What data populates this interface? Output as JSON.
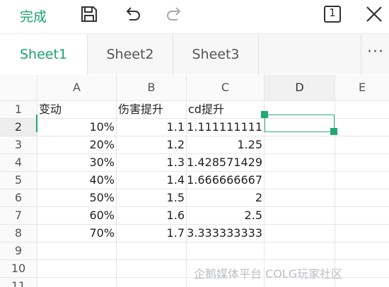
{
  "toolbar": {
    "done_label": "完成",
    "icons": [
      "save-icon",
      "undo-icon",
      "redo-icon",
      "sheet-count-icon",
      "close-icon"
    ],
    "sheet_count": "1",
    "accent": "#1aa36b"
  },
  "tabs": {
    "items": [
      {
        "label": "Sheet1",
        "active": true
      },
      {
        "label": "Sheet2",
        "active": false
      },
      {
        "label": "Sheet3",
        "active": false
      }
    ],
    "more_label": "···"
  },
  "grid": {
    "columns": [
      "A",
      "B",
      "C",
      "D",
      "E"
    ],
    "selected_column": "D",
    "rows": [
      "1",
      "2",
      "3",
      "4",
      "5",
      "6",
      "7",
      "8",
      "9",
      "10",
      "11"
    ],
    "selected_row": "2",
    "cells": {
      "header": [
        "变动",
        "伤害提升",
        "cd提升"
      ],
      "data": [
        [
          "10%",
          "1.1",
          "1.111111111"
        ],
        [
          "20%",
          "1.2",
          "1.25"
        ],
        [
          "30%",
          "1.3",
          "1.428571429"
        ],
        [
          "40%",
          "1.4",
          "1.666666667"
        ],
        [
          "50%",
          "1.5",
          "2"
        ],
        [
          "60%",
          "1.6",
          "2.5"
        ],
        [
          "70%",
          "1.7",
          "3.333333333"
        ]
      ]
    }
  },
  "watermark": "企鹅媒体平台 COLG玩家社区"
}
